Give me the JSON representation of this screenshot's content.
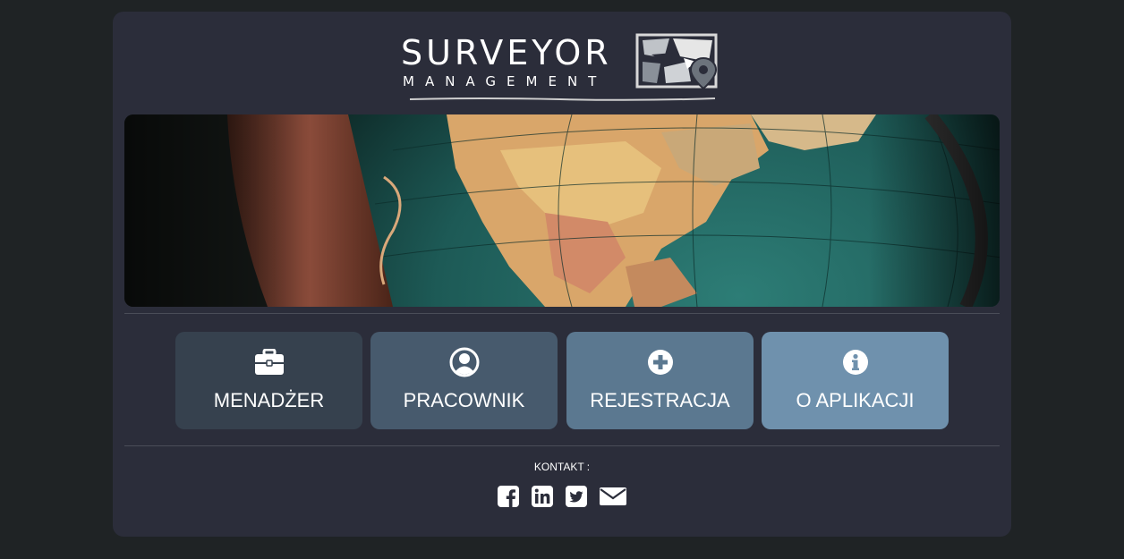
{
  "logo": {
    "title": "SURVEYOR",
    "subtitle": "MANAGEMENT"
  },
  "colors": {
    "page_bg": "#1f2325",
    "card_bg": "#2b2d3a",
    "btn_manager": "#36414e",
    "btn_worker": "#475a6d",
    "btn_register": "#5b7890",
    "btn_about": "#6f91ad"
  },
  "menu": {
    "manager": {
      "label": "MENADŻER",
      "icon": "briefcase-icon"
    },
    "worker": {
      "label": "PRACOWNIK",
      "icon": "user-circle-icon"
    },
    "register": {
      "label": "REJESTRACJA",
      "icon": "plus-circle-icon"
    },
    "about": {
      "label": "O APLIKACJI",
      "icon": "info-circle-icon"
    }
  },
  "footer": {
    "contact_label": "KONTAKT :",
    "socials": [
      "facebook-icon",
      "linkedin-icon",
      "twitter-icon",
      "envelope-icon"
    ]
  }
}
